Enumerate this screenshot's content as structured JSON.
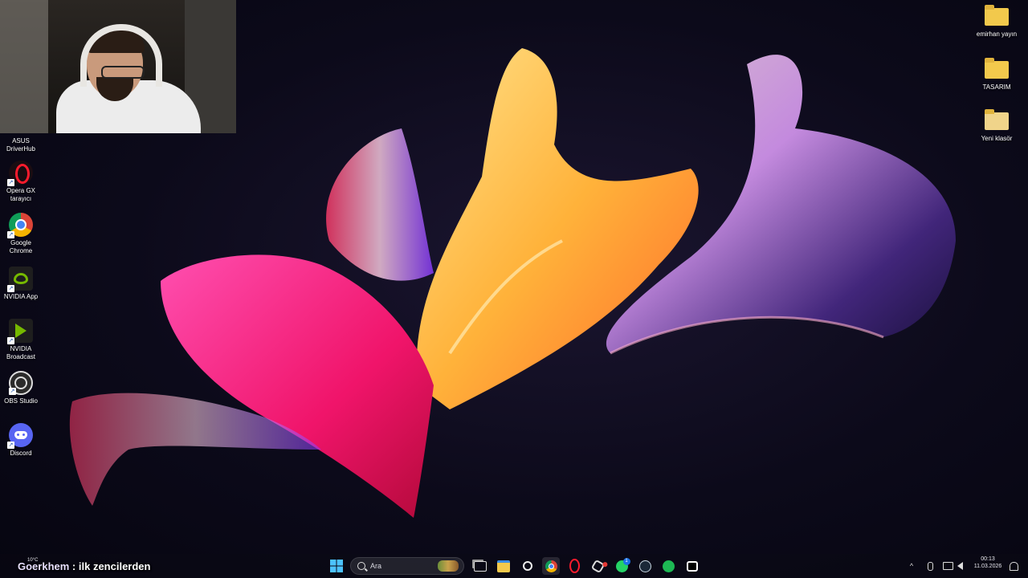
{
  "desktop": {
    "left_icons": [
      {
        "label": "ASUS DriverHub",
        "icon": "asus-driverhub-icon"
      },
      {
        "label": "Opera GX tarayıcı",
        "icon": "opera-gx-icon"
      },
      {
        "label": "Google Chrome",
        "icon": "chrome-icon"
      },
      {
        "label": "NVIDIA App",
        "icon": "nvidia-icon"
      },
      {
        "label": "NVIDIA Broadcast",
        "icon": "nvidia-broadcast-icon"
      },
      {
        "label": "OBS Studio",
        "icon": "obs-icon"
      },
      {
        "label": "Discord",
        "icon": "discord-icon"
      }
    ],
    "right_icons": [
      {
        "label": "emirhan yayın",
        "icon": "folder-icon"
      },
      {
        "label": "TASARIM",
        "icon": "folder-icon"
      },
      {
        "label": "Yeni klasör",
        "icon": "folder-icon"
      }
    ]
  },
  "webcam": {
    "label": "streamer webcam overlay"
  },
  "chat_caption": {
    "author": "Goerkhem",
    "separator": " : ",
    "message": "ilk zencilerden"
  },
  "taskbar": {
    "weather": {
      "temp": "10°C"
    },
    "search_placeholder": "Ara",
    "apps": [
      "start-icon",
      "task-view-icon",
      "file-explorer-icon",
      "steelseries-icon",
      "chrome-icon",
      "opera-gx-icon",
      "chatgpt-icon",
      "whatsapp-icon",
      "steam-icon",
      "spotify-icon",
      "capcut-icon"
    ],
    "whatsapp_badge": "1",
    "clock": {
      "time": "00:13",
      "date": "11.03.2026"
    }
  },
  "colors": {
    "accent_blue": "#1a73e8",
    "discord": "#5865f2",
    "nvidia": "#76b900",
    "spotify": "#1db954",
    "whatsapp": "#25d366",
    "opera": "#ff1b2d"
  }
}
